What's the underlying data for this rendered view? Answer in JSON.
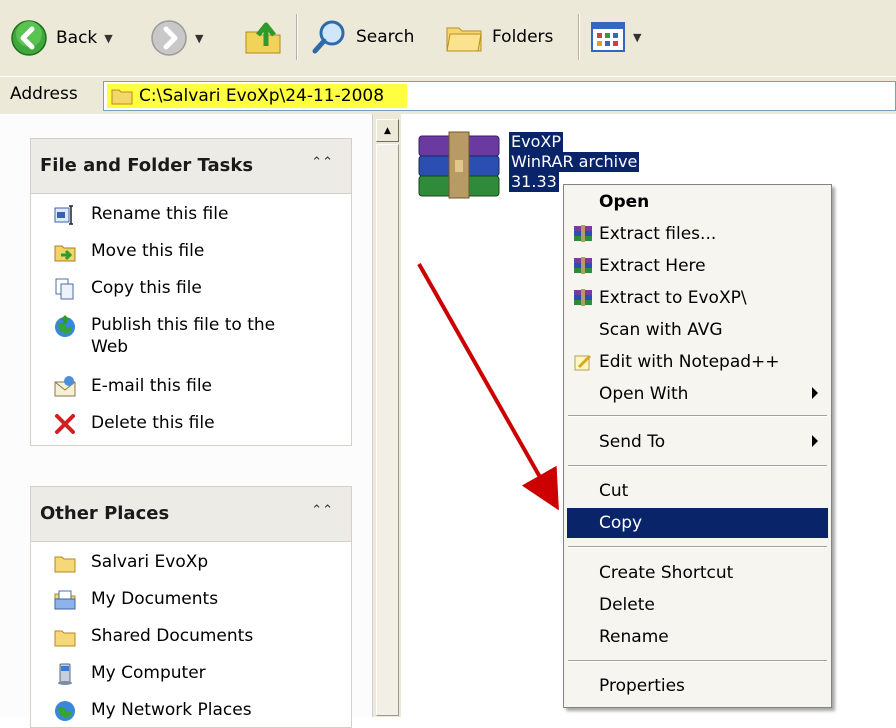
{
  "toolbar": {
    "back_label": "Back",
    "search_label": "Search",
    "folders_label": "Folders"
  },
  "address": {
    "label": "Address",
    "path": "C:\\Salvari EvoXp\\24-11-2008"
  },
  "tasks": {
    "file_folder_title": "File and Folder Tasks",
    "file_folder_items": [
      {
        "label": "Rename this file",
        "icon": "rename-icon"
      },
      {
        "label": "Move this file",
        "icon": "move-icon"
      },
      {
        "label": "Copy this file",
        "icon": "copy-icon"
      },
      {
        "label": "Publish this file to the Web",
        "icon": "publish-icon"
      },
      {
        "label": "E-mail this file",
        "icon": "email-icon"
      },
      {
        "label": "Delete this file",
        "icon": "delete-icon"
      }
    ],
    "other_places_title": "Other Places",
    "other_places_items": [
      {
        "label": "Salvari EvoXp",
        "icon": "folder-icon"
      },
      {
        "label": "My Documents",
        "icon": "my-documents-icon"
      },
      {
        "label": "Shared Documents",
        "icon": "folder-icon"
      },
      {
        "label": "My Computer",
        "icon": "my-computer-icon"
      },
      {
        "label": "My Network Places",
        "icon": "network-icon"
      }
    ]
  },
  "file": {
    "name": "EvoXP",
    "type": "WinRAR archive",
    "size": "31.33"
  },
  "context_menu": {
    "items": [
      {
        "label": "Open",
        "bold": true
      },
      {
        "label": "Extract files...",
        "icon": "winrar-icon"
      },
      {
        "label": "Extract Here",
        "icon": "winrar-icon"
      },
      {
        "label": "Extract to EvoXP\\",
        "icon": "winrar-icon"
      },
      {
        "label": "Scan with AVG"
      },
      {
        "label": "Edit with Notepad++",
        "icon": "notepad-icon"
      },
      {
        "label": "Open With",
        "submenu": true
      },
      {
        "label": "Send To",
        "submenu": true
      },
      {
        "label": "Cut"
      },
      {
        "label": "Copy",
        "selected": true
      },
      {
        "label": "Create Shortcut"
      },
      {
        "label": "Delete"
      },
      {
        "label": "Rename"
      },
      {
        "label": "Properties"
      }
    ]
  },
  "colors": {
    "selection": "#0a246a",
    "address_highlight": "#ffff40",
    "annotation_arrow": "#cc0000"
  }
}
